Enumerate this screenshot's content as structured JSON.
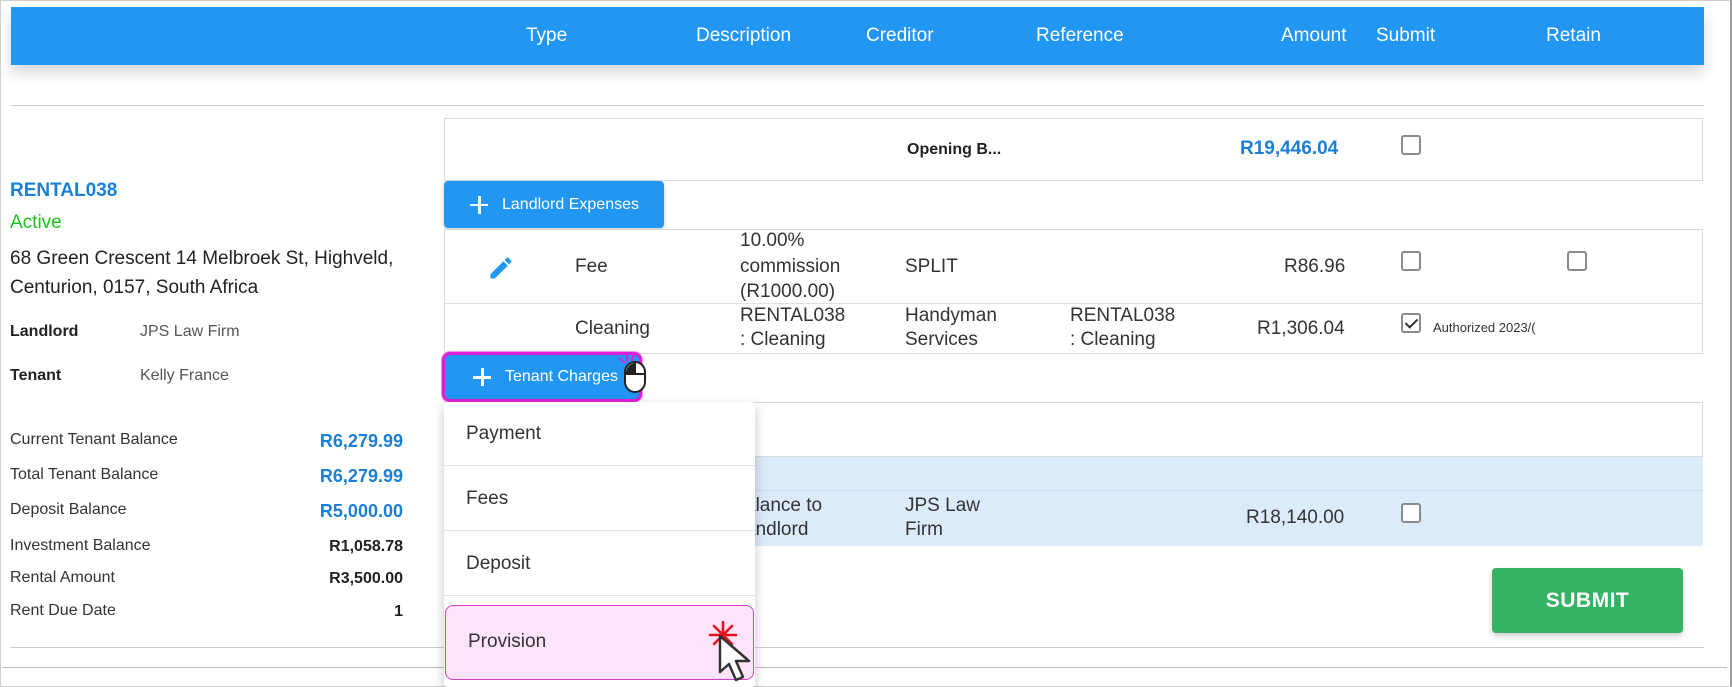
{
  "header": {
    "columns": [
      "Type",
      "Description",
      "Creditor",
      "Reference",
      "Amount",
      "Submit",
      "Retain"
    ]
  },
  "property": {
    "code": "RENTAL038",
    "status": "Active",
    "address": "68 Green Crescent 14 Melbroek St, Highveld, Centurion, 0157, South Africa",
    "landlord_label": "Landlord",
    "landlord": "JPS Law Firm",
    "tenant_label": "Tenant",
    "tenant": "Kelly France"
  },
  "balances": [
    {
      "label": "Current Tenant Balance",
      "value": "R6,279.99"
    },
    {
      "label": "Total Tenant Balance",
      "value": "R6,279.99"
    },
    {
      "label": "Deposit Balance",
      "value": "R5,000.00"
    },
    {
      "label": "Investment Balance",
      "value": "R1,058.78"
    },
    {
      "label": "Rental Amount",
      "value": "R3,500.00"
    },
    {
      "label": "Rent Due Date",
      "value": "1"
    }
  ],
  "opening_row": {
    "reference": "Opening B...",
    "amount": "R19,446.04",
    "submit_checked": false
  },
  "landlord_expenses_button": "Landlord Expenses",
  "expense_rows": [
    {
      "type": "Fee",
      "description_lines": [
        "10.00%",
        "commission",
        "(R1000.00)"
      ],
      "creditor_lines": [
        "SPLIT"
      ],
      "reference_lines": [],
      "amount": "R86.96",
      "submit_checked": false,
      "retain_checked": false
    },
    {
      "type": "Cleaning",
      "description_lines": [
        "RENTAL038",
        ": Cleaning"
      ],
      "creditor_lines": [
        "Handyman",
        "Services"
      ],
      "reference_lines": [
        "RENTAL038",
        ": Cleaning"
      ],
      "amount": "R1,306.04",
      "submit_checked": true,
      "authorized": "Authorized 2023/("
    }
  ],
  "tenant_charges_button": "Tenant Charges",
  "balance_row": {
    "description_lines": [
      "alance to",
      "andlord"
    ],
    "creditor_lines": [
      "JPS Law",
      "Firm"
    ],
    "amount": "R18,140.00",
    "submit_checked": false
  },
  "tenant_charges_menu": {
    "items": [
      "Payment",
      "Fees",
      "Deposit",
      "Provision"
    ],
    "active": "Provision"
  },
  "submit_button": "SUBMIT",
  "colors": {
    "accent": "#2196f3",
    "link_blue": "#1a7fd6",
    "active_green": "#19c419",
    "submit_green": "#36b265",
    "highlight_row": "#dcebfa",
    "menu_active_bg": "#fde4fb",
    "menu_active_border": "#d43fd0"
  },
  "icons": {
    "edit": "pencil-icon",
    "add": "plus-icon",
    "mouse": "mouse-icon",
    "cursor": "arrow-cursor-icon",
    "click": "click-burst-icon"
  }
}
